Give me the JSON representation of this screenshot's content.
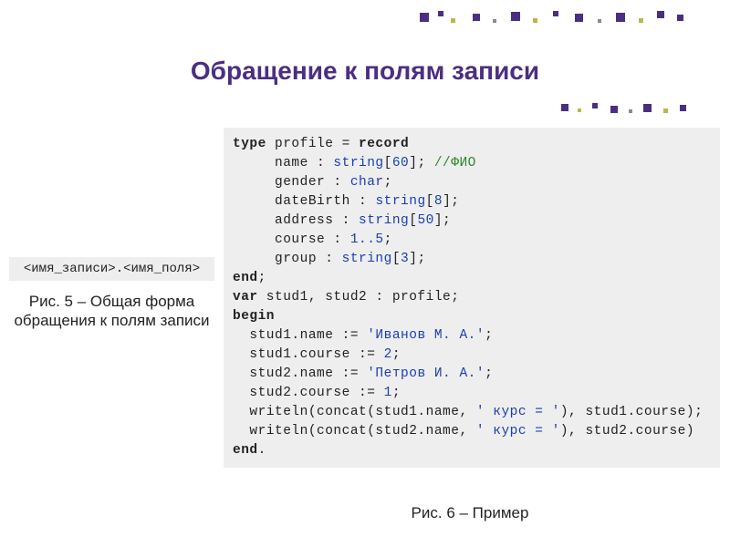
{
  "title": "Обращение к полям записи",
  "syntax_pattern": "<имя_записи>.<имя_поля>",
  "caption_fig5": "Рис. 5 – Общая форма обращения к полям записи",
  "caption_fig6": "Рис. 6 – Пример",
  "code": {
    "l1_kw1": "type",
    "l1_id": " profile = ",
    "l1_kw2": "record",
    "l2_a": "     name : ",
    "l2_ty": "string",
    "l2_b": "[",
    "l2_n": "60",
    "l2_c": "]; ",
    "l2_cmt": "//ФИО",
    "l3_a": "     gender : ",
    "l3_ty": "char",
    "l3_b": ";",
    "l4_a": "     dateBirth : ",
    "l4_ty": "string",
    "l4_b": "[",
    "l4_n": "8",
    "l4_c": "];",
    "l5_a": "     address : ",
    "l5_ty": "string",
    "l5_b": "[",
    "l5_n": "50",
    "l5_c": "];",
    "l6_a": "     course : ",
    "l6_r": "1..5",
    "l6_b": ";",
    "l7_a": "     group : ",
    "l7_ty": "string",
    "l7_b": "[",
    "l7_n": "3",
    "l7_c": "];",
    "l8_kw": "end",
    "l8_b": ";",
    "l9_kw": "var",
    "l9_b": " stud1, stud2 : profile;",
    "l10_kw": "begin",
    "l11_a": "  stud1.name := ",
    "l11_s": "'Иванов М. А.'",
    "l11_b": ";",
    "l12_a": "  stud1.course := ",
    "l12_n": "2",
    "l12_b": ";",
    "l13_a": "  stud2.name := ",
    "l13_s": "'Петров И. А.'",
    "l13_b": ";",
    "l14_a": "  stud2.course := ",
    "l14_n": "1",
    "l14_b": ";",
    "l15_a": "  writeln(concat(stud1.name, ",
    "l15_s": "' курс = '",
    "l15_b": "), stud1.course);",
    "l16_a": "  writeln(concat(stud2.name, ",
    "l16_s": "' курс = '",
    "l16_b": "), stud2.course)",
    "l17_kw": "end",
    "l17_b": "."
  }
}
